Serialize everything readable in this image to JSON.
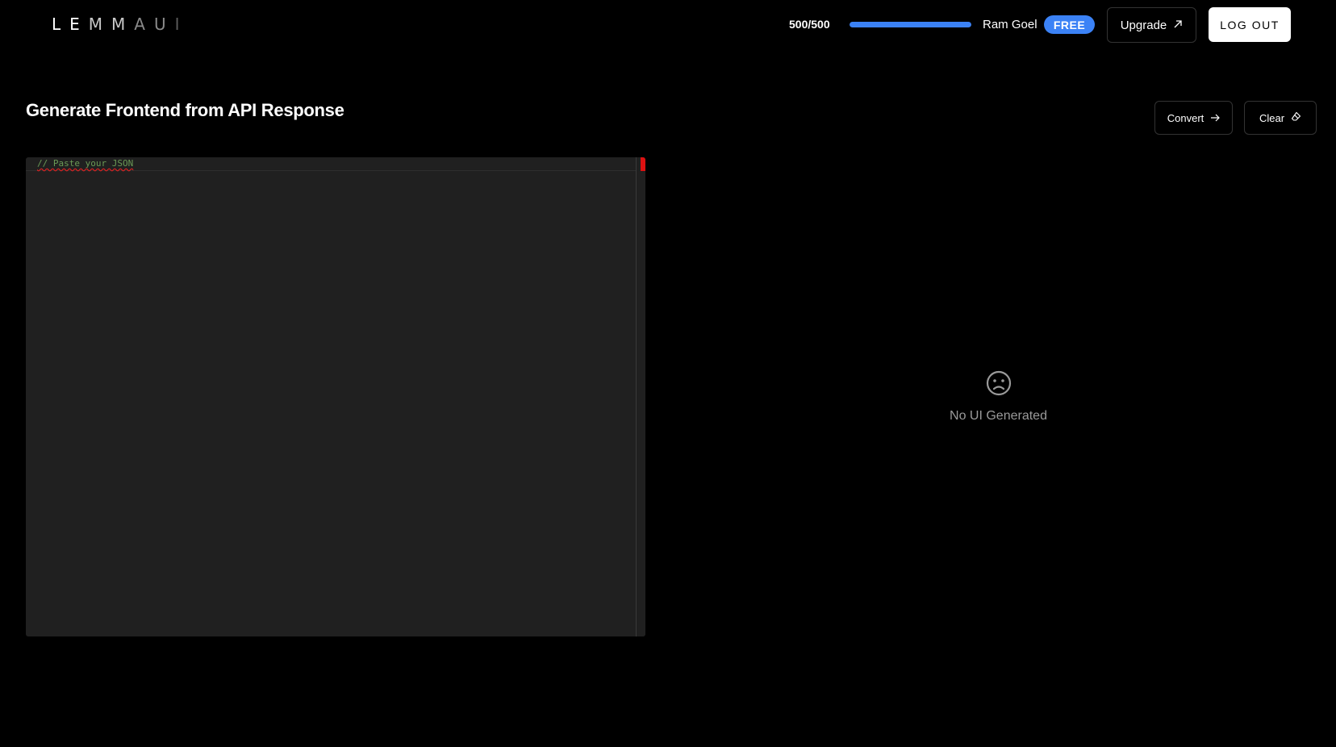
{
  "header": {
    "logo": [
      "LE",
      "MM",
      "AU",
      "I"
    ],
    "usage": {
      "label": "500/500",
      "used": 500,
      "limit": 500
    },
    "user_name": "Ram Goel",
    "plan_badge": "FREE",
    "upgrade_label": "Upgrade",
    "logout_label": "LOG OUT"
  },
  "main": {
    "title": "Generate Frontend from API Response",
    "convert_label": "Convert",
    "clear_label": "Clear",
    "editor": {
      "content": "// Paste your JSON"
    },
    "output": {
      "empty_message": "No UI Generated"
    }
  },
  "colors": {
    "accent": "#3b82f6",
    "background": "#000000",
    "editor_bg": "#202020",
    "comment": "#6a9955",
    "error": "#dd1111"
  },
  "icons": {
    "upgrade": "arrow-up-right-icon",
    "convert": "arrow-right-icon",
    "clear": "eraser-icon",
    "empty": "sad-face-icon"
  }
}
